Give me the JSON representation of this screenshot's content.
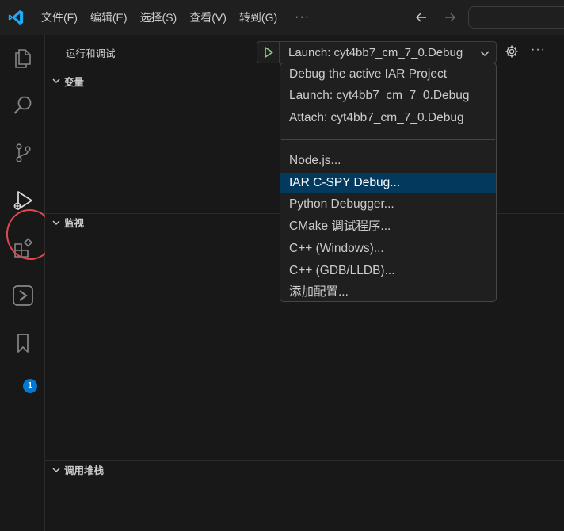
{
  "menu": {
    "items": [
      "文件(F)",
      "编辑(E)",
      "选择(S)",
      "查看(V)",
      "转到(G)"
    ],
    "more": "···"
  },
  "activitybar": {
    "items": [
      "explorer-icon",
      "search-icon",
      "source-control-icon",
      "run-debug-icon",
      "extensions-icon",
      "remote-icon",
      "bookmarks-icon"
    ],
    "bookmarks_badge": "1",
    "accent_color": "#0078d4",
    "highlight_color": "#e0484f"
  },
  "sidebar": {
    "title": "运行和调试",
    "run_config": "Launch: cyt4bb7_cm_7_0.Debug",
    "more": "···",
    "sections": {
      "variables": "变量",
      "watch": "监视",
      "callstack": "调用堆栈"
    }
  },
  "dropdown": {
    "group1": [
      "Debug the active IAR Project",
      "Launch: cyt4bb7_cm_7_0.Debug",
      "Attach: cyt4bb7_cm_7_0.Debug"
    ],
    "group2": [
      "Node.js...",
      "IAR C-SPY Debug...",
      "Python Debugger...",
      "CMake 调试程序...",
      "C++ (Windows)...",
      "C++ (GDB/LLDB)...",
      "添加配置..."
    ],
    "selected": "IAR C-SPY Debug...",
    "selected_color": "#04395e"
  },
  "colors": {
    "run_green": "#89d185",
    "background": "#181818"
  }
}
